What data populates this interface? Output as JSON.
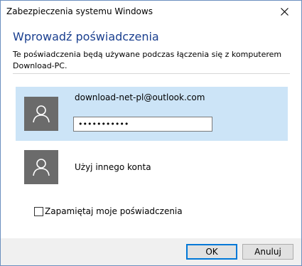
{
  "window": {
    "title": "Zabezpieczenia systemu Windows"
  },
  "dialog": {
    "heading": "Wprowadź poświadczenia",
    "description": "Te poświadczenia będą używane podczas łączenia się z komputerem Download-PC."
  },
  "accounts": {
    "selected": {
      "email": "download-net-pl@outlook.com",
      "password_masked": "•••••••••••"
    },
    "other": {
      "label": "Użyj innego konta"
    }
  },
  "remember": {
    "label": "Zapamiętaj moje poświadczenia",
    "checked": false
  },
  "buttons": {
    "ok": "OK",
    "cancel": "Anuluj"
  },
  "colors": {
    "heading": "#1a3f8f",
    "selected_bg": "#cce4f7",
    "accent": "#0078d7",
    "avatar_bg": "#6b6b6b"
  },
  "icons": {
    "close": "close-icon",
    "avatar": "user-icon"
  }
}
